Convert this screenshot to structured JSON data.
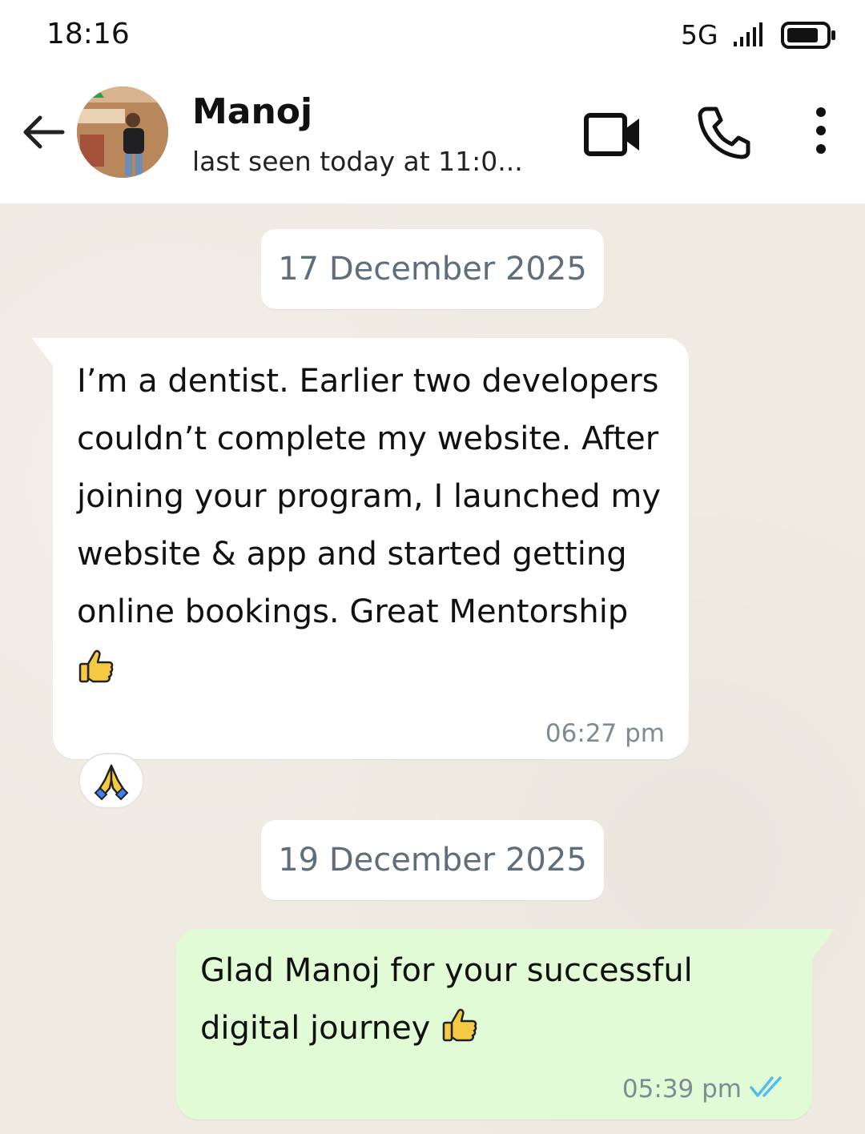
{
  "status_bar": {
    "time": "18:16",
    "network": "5G"
  },
  "header": {
    "contact_name": "Manoj",
    "last_seen": "last seen today at 11:0...",
    "icons": [
      "back-arrow-icon",
      "video-call-icon",
      "phone-icon",
      "more-vertical-icon"
    ]
  },
  "chat": {
    "dates": [
      "17 December 2025",
      "19 December 2025"
    ],
    "incoming": {
      "text": "I’m a dentist. Earlier two developers couldn’t complete my website. After joining your program, I launched my website & app and started getting online bookings. Great Mentorship",
      "emoji": "thumbs-up",
      "time": "06:27 pm",
      "reaction": "folded-hands"
    },
    "outgoing": {
      "text": "Glad Manoj for your successful digital journey",
      "emoji": "thumbs-up",
      "time": "05:39 pm",
      "status": "read"
    }
  },
  "colors": {
    "chat_background": "#efeae2",
    "incoming_bubble": "#ffffff",
    "outgoing_bubble": "#e1fbd6",
    "read_ticks": "#53bdeb"
  }
}
